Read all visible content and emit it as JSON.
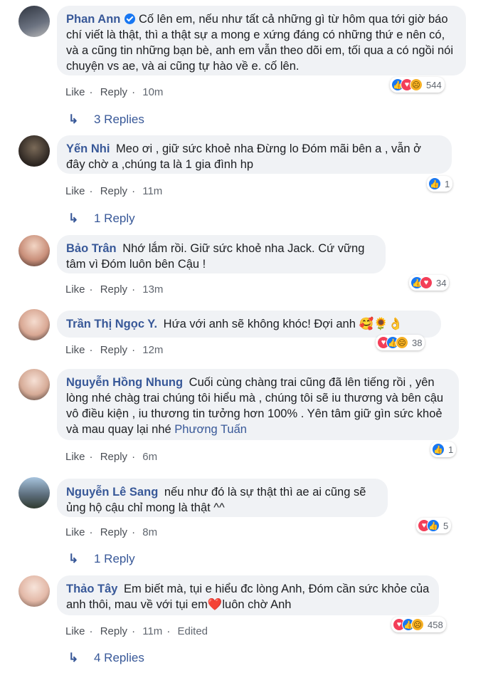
{
  "actions": {
    "like": "Like",
    "reply": "Reply",
    "dot": "·"
  },
  "comments": [
    {
      "name": "Phan Ann",
      "verified": true,
      "text": "Cố lên em, nếu như tất cả những gì từ hôm qua tới giờ báo chí viết là thật, thì a thật sự a mong e xứng đáng có những thứ e nên có, và a cũng tin những bạn bè, anh em vẫn theo dõi em, tối qua a có ngồi nói chuyện vs ae, và ai cũng tự hào về e. cố lên.",
      "time": "10m",
      "reaction_count": "544",
      "replies": "3 Replies"
    },
    {
      "name": "Yến Nhi",
      "text": "Meo ơi , giữ sức khoẻ nha Đừng lo Đóm mãi bên a , vẫn ở đây chờ a ,chúng ta là 1 gia đình hp",
      "time": "11m",
      "reaction_count": "1",
      "replies": "1 Reply"
    },
    {
      "name": "Bảo Trân",
      "text": "Nhớ lắm rồi. Giữ sức khoẻ nha Jack. Cứ vững tâm vì Đóm luôn bên Cậu !",
      "time": "13m",
      "reaction_count": "34"
    },
    {
      "name": "Trần Thị Ngọc Y.",
      "text": "Hứa với anh sẽ không khóc! Đợi anh 🥰🌻👌",
      "time": "12m",
      "reaction_count": "38"
    },
    {
      "name": "Nguyễn Hồng Nhung",
      "text": "Cuối cùng chàng trai cũng đã lên tiếng rồi , yên lòng nhé chàg trai chúng tôi hiểu mà , chúng tôi sẽ iu thương và bên cậu vô điều kiện , iu thương tin tưởng hơn 100% . Yên tâm giữ gìn sức khoẻ và mau quay lại nhé",
      "tag": "Phương Tuấn",
      "time": "6m",
      "reaction_count": "1"
    },
    {
      "name": "Nguyễn Lê Sang",
      "text": "nếu như đó là sự thật thì ae ai cũng sẽ ủng hộ cậu chỉ mong là thật ^^",
      "time": "8m",
      "reaction_count": "5",
      "replies": "1 Reply"
    },
    {
      "name": "Thảo Tây",
      "text": "Em biết mà, tụi e hiểu đc lòng Anh, Đóm cần sức khỏe của anh thôi, mau về với tụi em❤️luôn chờ Anh",
      "time": "11m",
      "edited": "Edited",
      "reaction_count": "458",
      "replies": "4 Replies"
    }
  ],
  "icons": {
    "verified": "verified-check-icon",
    "reply_arrow": "reply-arrow-icon",
    "like": "like-reaction-icon",
    "love": "love-reaction-icon",
    "sad": "sad-reaction-icon"
  },
  "colors": {
    "name": "#385898",
    "bubble": "#f0f2f5",
    "like": "#1877f2",
    "love": "#f33e58",
    "sad": "#f7b125"
  }
}
